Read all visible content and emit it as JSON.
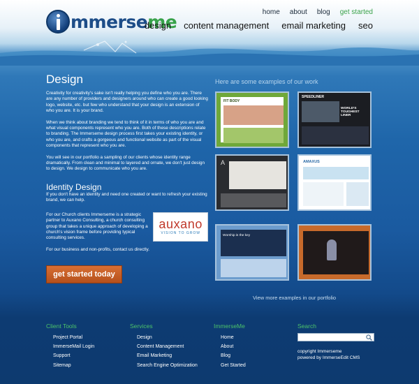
{
  "brand": {
    "logo_main": "mmerse",
    "logo_accent": "me"
  },
  "topnav": [
    "home",
    "about",
    "blog",
    "get started"
  ],
  "mainnav": [
    "design",
    "content management",
    "email marketing",
    "seo"
  ],
  "design": {
    "title": "Design",
    "p1": "Creativity for creativity's sake isn't really helping you define who you are. There are any number of providers and designers around who can create a good looking logo, website, etc. but few who understand that your design is an extension of who you are. It is your brand.",
    "p2": "When we think about branding we tend to think of it in terms of who you are and what visual components represent who you are. Both of these descriptions relate to branding. The Immerseme design process first takes your existing identity, or who you are, and crafts a gorgeous and functional website as part of the visual components that represent who you are.",
    "p3": "You will see in our portfolio a sampling of our clients whose identity range dramatically. From clean and minimal to layered and ornate, we don't just design to design. We design to communicate who you are."
  },
  "identity": {
    "title": "Identity Design",
    "p1": "If you don't have an identity and need one created or want to refresh your existing brand, we can help.",
    "p2": "For our Church clients Immerseme is a strategic partner to Auxano Consulting, a church consulting group that takes a unique approach of developing a church's vision frame before providing typical consulting services.",
    "p3": "For our business and non-profits, contact us directly.",
    "logo_word": "auxano",
    "logo_tag": "VISION TO GROW"
  },
  "cta": "get started today",
  "examples": {
    "title": "Here are some examples of our work",
    "thumbs": [
      {
        "caption": "FIT BODY"
      },
      {
        "caption": "SPEEDLINER",
        "headline": "WORLD'S TOUGHEST LINER"
      },
      {
        "caption": "A"
      },
      {
        "caption": "AMAXUS"
      },
      {
        "caption": "Worship is the key"
      },
      {
        "caption": ""
      }
    ],
    "more": "View more examples in our portfolio"
  },
  "footer": {
    "client_tools": {
      "title": "Client Tools",
      "links": [
        "Project Portal",
        "ImmerseMail Login",
        "Support",
        "Sitemap"
      ]
    },
    "services": {
      "title": "Services",
      "links": [
        "Design",
        "Content Management",
        "Email Marketing",
        "Search Engine Optimization"
      ]
    },
    "immerseme": {
      "title": "ImmerseMe",
      "links": [
        "Home",
        "About",
        "Blog",
        "Get Started"
      ]
    },
    "search": {
      "title": "Search",
      "placeholder": ""
    },
    "copyright": "copyright Immerseme",
    "powered": "powered by ImmerseEdit CMS"
  },
  "colors": {
    "accent_green": "#3aa24a",
    "cta_orange": "#c45d26",
    "logo_blue": "#1d4d88"
  }
}
